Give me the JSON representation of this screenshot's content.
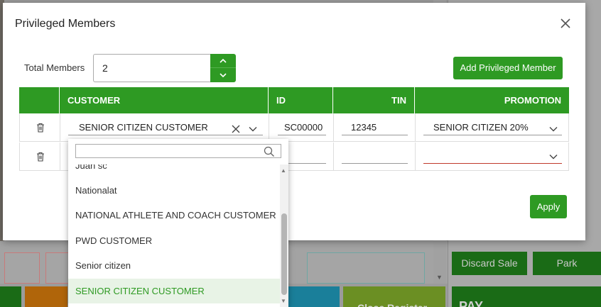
{
  "modal": {
    "title": "Privileged Members",
    "total_members_label": "Total Members",
    "total_members_value": "2",
    "add_button": "Add Privileged Member",
    "apply_button": "Apply"
  },
  "table": {
    "headers": {
      "customer": "CUSTOMER",
      "id": "ID",
      "tin": "TIN",
      "promotion": "PROMOTION"
    },
    "rows": [
      {
        "customer": "SENIOR CITIZEN CUSTOMER",
        "id": "SC00000",
        "tin": "12345",
        "promotion": "SENIOR CITIZEN 20%"
      },
      {
        "customer": "",
        "id": "",
        "tin": "",
        "promotion": ""
      }
    ]
  },
  "dropdown": {
    "search_placeholder": "",
    "options": [
      "Juan sc",
      "Nationalat",
      "NATIONAL ATHLETE AND COACH CUSTOMER",
      "PWD CUSTOMER",
      "Senior citizen",
      "SENIOR CITIZEN CUSTOMER"
    ],
    "selected": "SENIOR CITIZEN CUSTOMER"
  },
  "background": {
    "discard_button": "Discard Sale",
    "park_button": "Park",
    "close_register_button": "Close Register",
    "pay_label": "PAY"
  },
  "colors": {
    "accent": "#2e9a23",
    "selected_bg": "#e8f3e6",
    "error_underline": "#c0392b"
  }
}
